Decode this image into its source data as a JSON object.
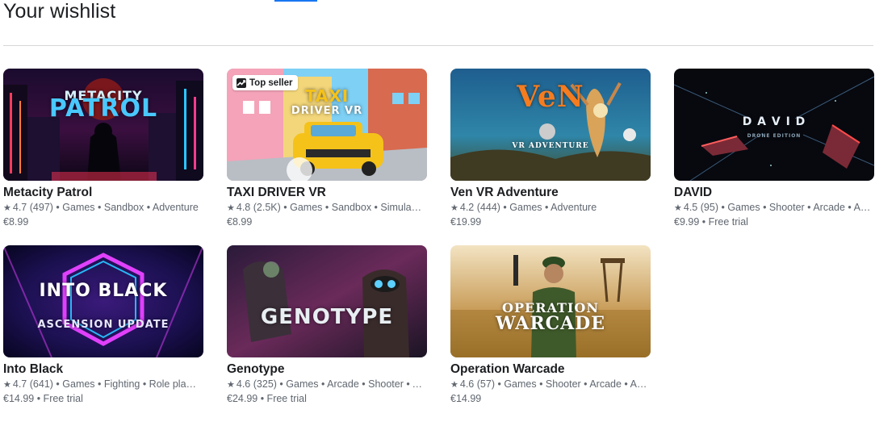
{
  "page": {
    "title": "Your wishlist"
  },
  "badge_label": "Top seller",
  "cards": [
    {
      "name": "Metacity Patrol",
      "rating": "4.7",
      "count": "(497)",
      "tags": "Games • Sandbox • Adventure",
      "price": "€8.99",
      "art_title": "METACITY",
      "art_sub": "PATROL"
    },
    {
      "name": "TAXI DRIVER VR",
      "rating": "4.8",
      "count": "(2.5K)",
      "tags": "Games • Sandbox • Simulation",
      "price": "€8.99",
      "art_title": "TAXI",
      "art_sub": "DRIVER VR"
    },
    {
      "name": "Ven VR Adventure",
      "rating": "4.2",
      "count": "(444)",
      "tags": "Games • Adventure",
      "price": "€19.99",
      "art_title": "VeN",
      "art_sub": "VR ADVENTURE"
    },
    {
      "name": "DAVID",
      "rating": "4.5",
      "count": "(95)",
      "tags": "Games • Shooter • Arcade • Action",
      "price": "€9.99 • Free trial",
      "art_title": "D A V I D",
      "art_sub": "DRONE EDITION"
    },
    {
      "name": "Into Black",
      "rating": "4.7",
      "count": "(641)",
      "tags": "Games • Fighting • Role playing",
      "price": "€14.99 • Free trial",
      "art_title": "INTO BLACK",
      "art_sub": "ASCENSION UPDATE"
    },
    {
      "name": "Genotype",
      "rating": "4.6",
      "count": "(325)",
      "tags": "Games • Arcade • Shooter • Action",
      "price": "€24.99 • Free trial",
      "art_title": "GENOTYPE",
      "art_sub": ""
    },
    {
      "name": "Operation Warcade",
      "rating": "4.6",
      "count": "(57)",
      "tags": "Games • Shooter • Arcade • Action",
      "price": "€14.99",
      "art_title": "OPERATION",
      "art_sub": "WARCADE"
    }
  ]
}
